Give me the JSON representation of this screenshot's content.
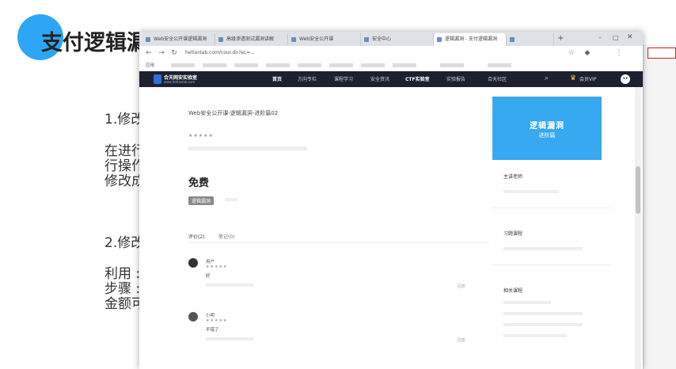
{
  "slide": {
    "title": "支付逻辑漏",
    "lines": [
      "1.修改",
      "在进行",
      "行操作",
      "修改成",
      "2.修改",
      "利用 :",
      "步骤 :",
      "金额可"
    ]
  },
  "browser": {
    "tabs": [
      "Web安全公开课逻辑漏洞",
      "高级渗透测试漏洞讲解",
      "Web安全公开课",
      "安全中心",
      "逻辑漏洞 - 支付逻辑漏洞",
      "",
      ""
    ],
    "url": "hetianlab.com/cour.do?ec=...",
    "bookmarks": [
      "应用",
      "",
      "",
      "",
      "",
      "",
      "",
      "",
      "",
      "",
      ""
    ]
  },
  "site": {
    "logo": "合天网安实验室",
    "logo_sub": "www.hetianlab.com",
    "nav": [
      "首页",
      "方向专栏",
      "课程学习",
      "安全资讯",
      "CTF实验室",
      "实验报告",
      "合天社区"
    ],
    "vip": "会员VIP",
    "avatar": "••"
  },
  "course": {
    "title": "Web安全公开课-逻辑漏洞-进阶篇02",
    "stars": "★★★★★",
    "price": "免费",
    "tag": "逻辑漏洞",
    "tab_review": "评价(2)",
    "tab_notes": "笔记(0)"
  },
  "reviews": [
    {
      "name": "用户",
      "stars": "★★★★★",
      "text": "好",
      "action": "回复"
    },
    {
      "name": "小明",
      "stars": "★★★★★",
      "text": "不错了",
      "action": "回复"
    }
  ],
  "sidebar": {
    "banner_title": "逻辑漏洞",
    "banner_sub": "进阶篇",
    "instructor_heading": "主讲老师",
    "path_heading": "习题课程",
    "related_heading": "相关课程"
  }
}
